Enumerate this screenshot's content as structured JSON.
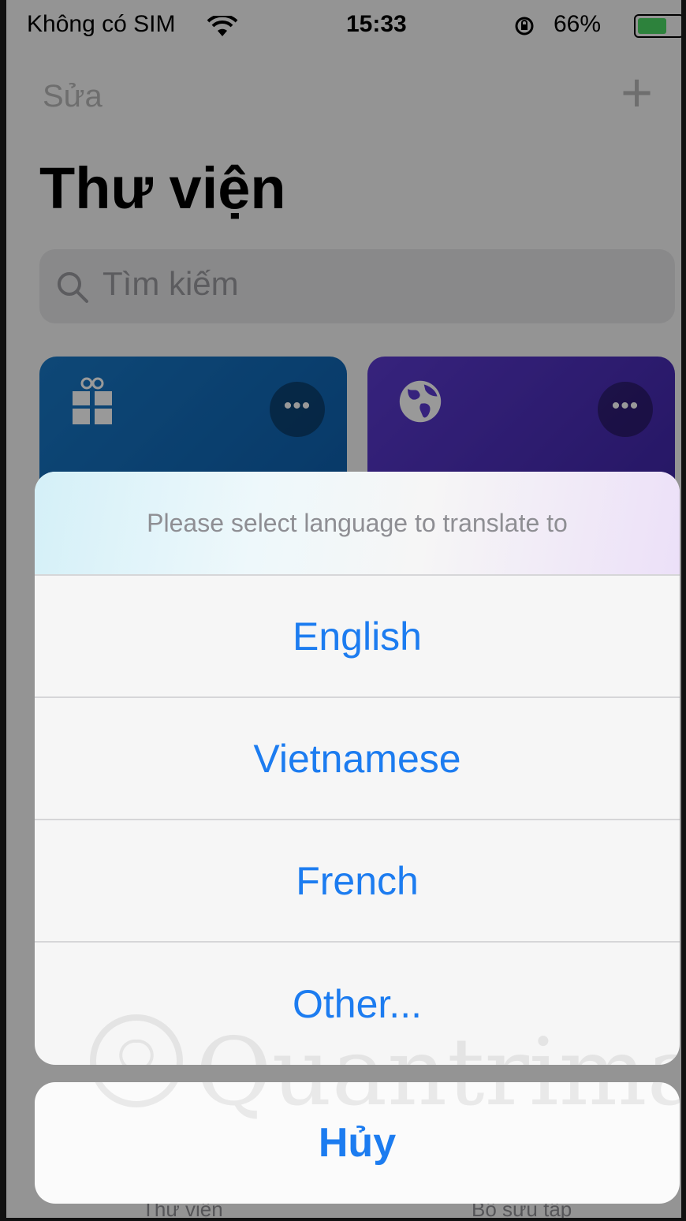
{
  "status_bar": {
    "carrier": "Không có SIM",
    "time": "15:33",
    "battery_percent": "66%",
    "battery_level": 0.66,
    "battery_color": "#4cd964"
  },
  "nav": {
    "edit_label": "Sửa",
    "add_icon": "plus-icon",
    "title": "Thư viện"
  },
  "search": {
    "placeholder": "Tìm kiếm",
    "icon": "search-icon"
  },
  "cards": [
    {
      "icon": "gift-icon",
      "color": "#1878c6",
      "more_label": "•••"
    },
    {
      "icon": "globe-icon",
      "color": "#5b3ad0",
      "more_label": "•••"
    }
  ],
  "tab_bar": {
    "items": [
      {
        "label": "Thư viện"
      },
      {
        "label": "Bộ sưu tập"
      }
    ]
  },
  "action_sheet": {
    "title": "Please select language to translate to",
    "options": [
      {
        "label": "English"
      },
      {
        "label": "Vietnamese"
      },
      {
        "label": "French"
      },
      {
        "label": "Other..."
      }
    ],
    "cancel_label": "Hủy",
    "accent_color": "#1c7cf0"
  },
  "watermark": {
    "text": "Quantrimang"
  }
}
